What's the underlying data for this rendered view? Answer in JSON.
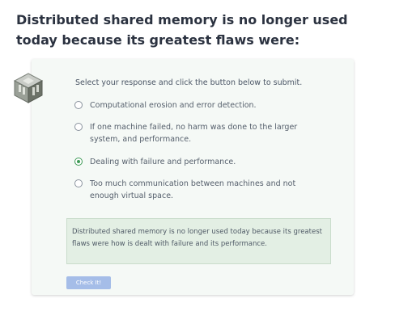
{
  "question": {
    "title": "Distributed shared memory is no longer used today because its greatest flaws were:"
  },
  "quiz": {
    "icon": "quiz-cube-icon",
    "instruction": "Select your response and click the button below to submit.",
    "options": [
      {
        "label": "Computational erosion and error detection.",
        "selected": false
      },
      {
        "label": "If one machine failed, no harm was done to the larger system, and performance.",
        "selected": false
      },
      {
        "label": "Dealing with failure and performance.",
        "selected": true
      },
      {
        "label": "Too much communication between machines and not enough virtual space.",
        "selected": false
      }
    ],
    "feedback": "Distributed shared memory is no longer used today because its greatest flaws were how is dealt with failure and its performance.",
    "submit_label": "Check It!"
  },
  "colors": {
    "card_background": "#f5f9f6",
    "feedback_background": "#e3efe4",
    "selected_radio": "#3f9a57",
    "button_background": "#a5bde8"
  }
}
